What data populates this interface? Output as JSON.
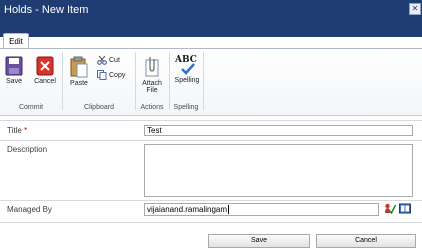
{
  "window": {
    "title": "Holds - New Item",
    "close_glyph": "✕"
  },
  "ribbon": {
    "tabs": [
      {
        "label": "Edit"
      }
    ],
    "groups": [
      {
        "label": "Commit",
        "buttons": [
          {
            "label": "Save",
            "icon": "save-icon"
          },
          {
            "label": "Cancel",
            "icon": "cancel-icon"
          }
        ]
      },
      {
        "label": "Clipboard",
        "buttons": [
          {
            "label": "Paste",
            "icon": "paste-icon"
          },
          {
            "label": "Cut",
            "icon": "cut-icon"
          },
          {
            "label": "Copy",
            "icon": "copy-icon"
          }
        ]
      },
      {
        "label": "Actions",
        "buttons": [
          {
            "label_line1": "Attach",
            "label_line2": "File",
            "icon": "attach-file-icon"
          }
        ]
      },
      {
        "label": "Spelling",
        "buttons": [
          {
            "label": "Spelling",
            "icon": "spelling-icon",
            "icon_text": "ABC"
          }
        ]
      }
    ]
  },
  "form": {
    "fields": [
      {
        "label": "Title",
        "required_mark": "*",
        "value": "Test"
      },
      {
        "label": "Description",
        "value": ""
      },
      {
        "label": "Managed By",
        "value": "vijaianand.ramalingam"
      }
    ],
    "buttons": {
      "save": "Save",
      "cancel": "Cancel"
    }
  },
  "colors": {
    "titlebar": "#1f3d72",
    "required": "#c00000"
  }
}
